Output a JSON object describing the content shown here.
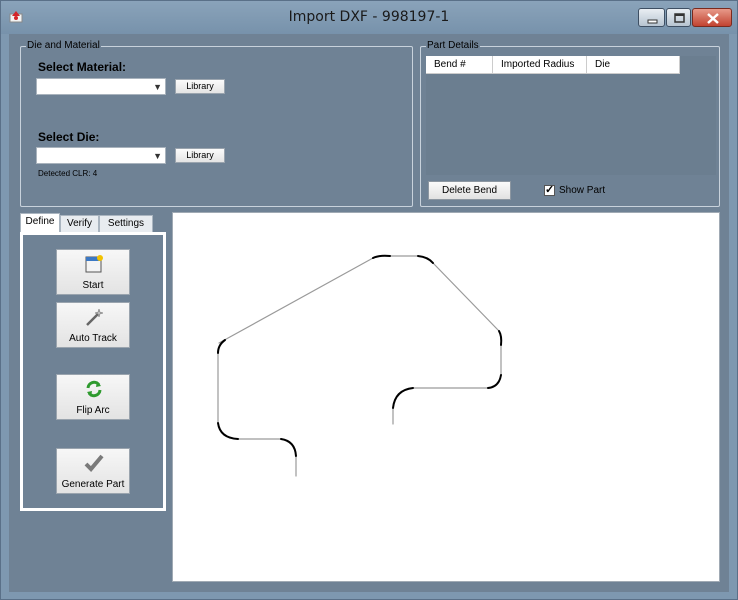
{
  "window": {
    "title": "Import DXF - 998197-1"
  },
  "die_material": {
    "group_label": "Die and Material",
    "material_label": "Select Material:",
    "material_value": "",
    "material_library": "Library",
    "die_label": "Select Die:",
    "die_value": "",
    "die_library": "Library",
    "detected_clr": "Detected CLR: 4"
  },
  "part_details": {
    "group_label": "Part Details",
    "columns": [
      "Bend #",
      "Imported Radius",
      "Die"
    ],
    "delete_bend": "Delete Bend",
    "show_part": "Show Part",
    "show_part_checked": true
  },
  "tabs": [
    "Define",
    "Verify",
    "Settings"
  ],
  "tools": {
    "start": "Start",
    "auto_track": "Auto Track",
    "flip_arc": "Flip Arc",
    "generate_part": "Generate Part"
  }
}
